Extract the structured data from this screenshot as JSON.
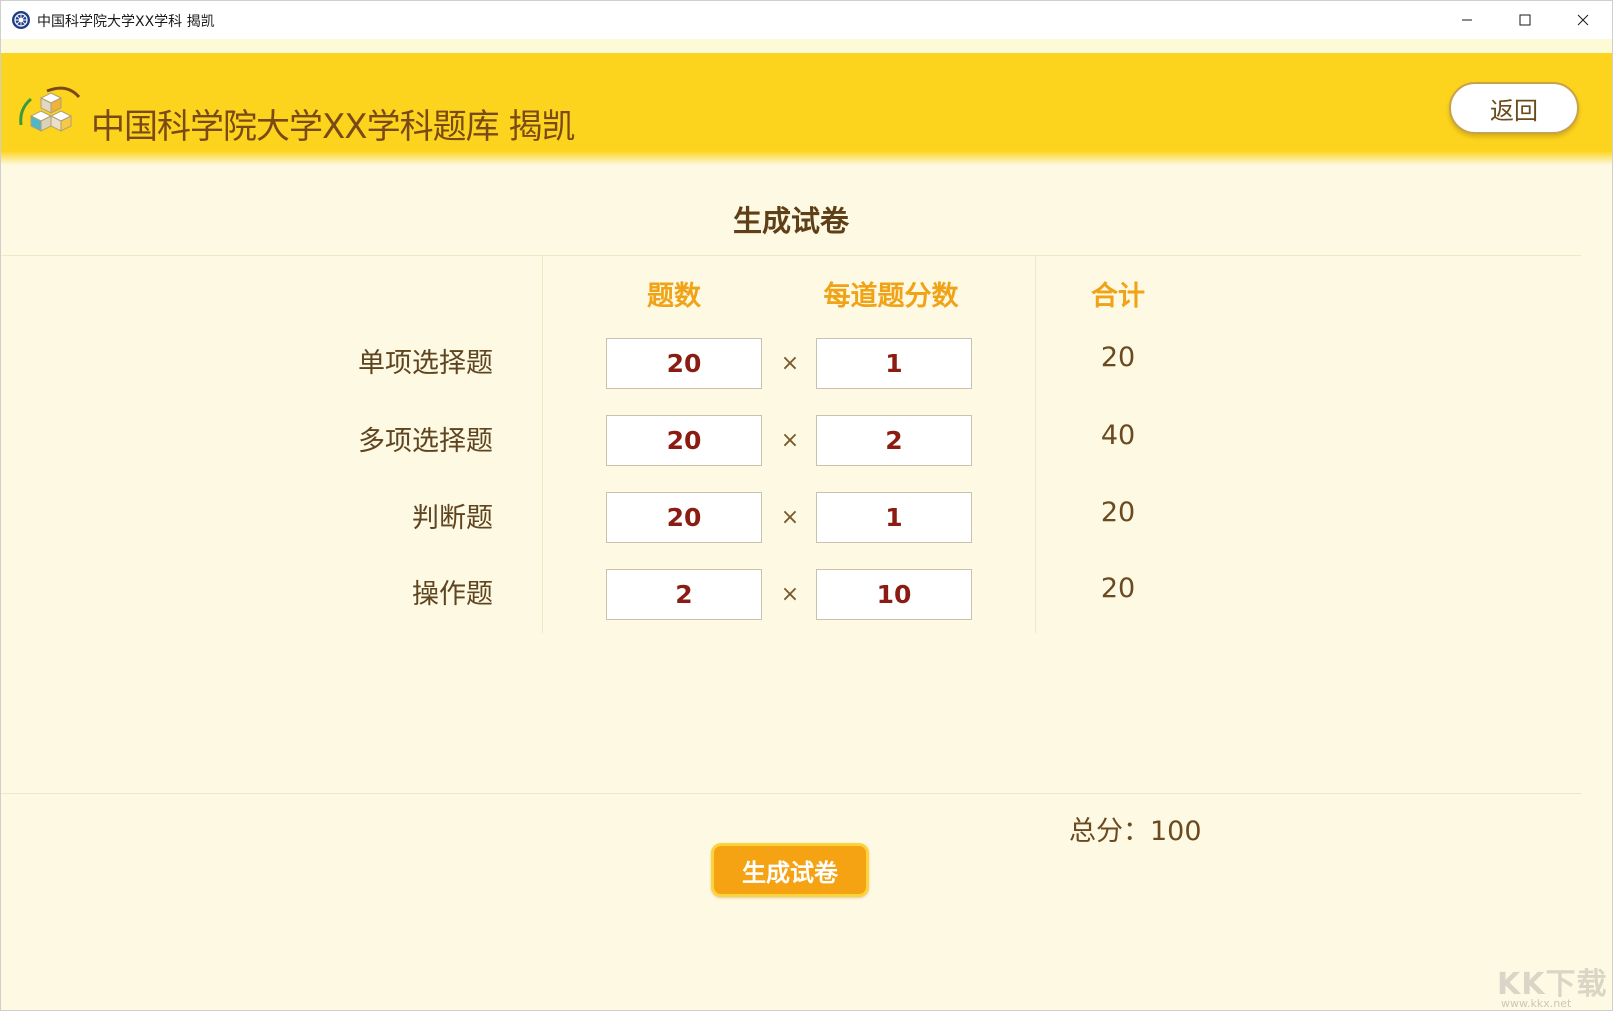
{
  "window": {
    "title": "中国科学院大学XX学科 揭凯",
    "minimize_glyph": "─",
    "maximize_glyph": "☐",
    "close_glyph": "✕"
  },
  "header": {
    "title": "中国科学院大学XX学科题库 揭凯",
    "back_label": "返回"
  },
  "main": {
    "section_title": "生成试卷",
    "columns": {
      "count": "题数",
      "per_score": "每道题分数",
      "subtotal": "合计"
    },
    "times_symbol": "×",
    "rows": [
      {
        "label": "单项选择题",
        "count": "20",
        "per_score": "1",
        "subtotal": "20"
      },
      {
        "label": "多项选择题",
        "count": "20",
        "per_score": "2",
        "subtotal": "40"
      },
      {
        "label": "判断题",
        "count": "20",
        "per_score": "1",
        "subtotal": "20"
      },
      {
        "label": "操作题",
        "count": "2",
        "per_score": "10",
        "subtotal": "20"
      }
    ],
    "total_text": "总分：100",
    "generate_label": "生成试卷"
  },
  "watermark": {
    "logo_text": "KK下载",
    "url": "www.kkx.net"
  },
  "colors": {
    "header_yellow": "#fdd41d",
    "accent_orange": "#f5a213",
    "value_red": "#8b1c14",
    "page_bg": "#fdf9e2"
  }
}
